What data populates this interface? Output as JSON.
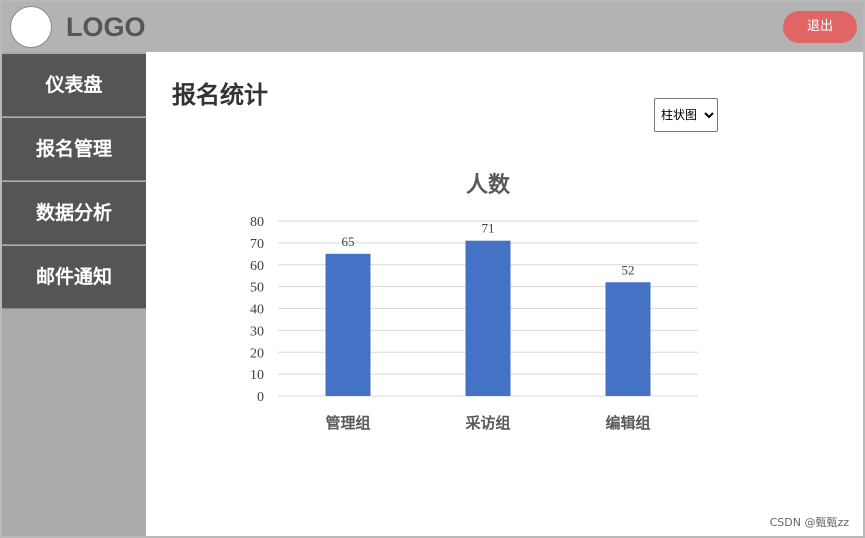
{
  "header": {
    "logo_text": "LOGO",
    "logout_label": "退出"
  },
  "sidebar": {
    "items": [
      {
        "label": "仪表盘"
      },
      {
        "label": "报名管理"
      },
      {
        "label": "数据分析"
      },
      {
        "label": "邮件通知"
      }
    ]
  },
  "main": {
    "title": "报名统计",
    "chart_type_select": {
      "selected": "柱状图"
    }
  },
  "chart_data": {
    "type": "bar",
    "title": "人数",
    "categories": [
      "管理组",
      "采访组",
      "编辑组"
    ],
    "values": [
      65,
      71,
      52
    ],
    "ylim": [
      0,
      80
    ],
    "yticks": [
      0,
      10,
      20,
      30,
      40,
      50,
      60,
      70,
      80
    ],
    "grid": true,
    "bar_color": "#4472c4"
  },
  "watermark": "CSDN @甄甄zz",
  "colors": {
    "header_bg": "#b3b3b3",
    "sidebar_bg": "#aaaaaa",
    "sidebar_item_bg": "#555555",
    "logout_bg": "#e06666"
  }
}
